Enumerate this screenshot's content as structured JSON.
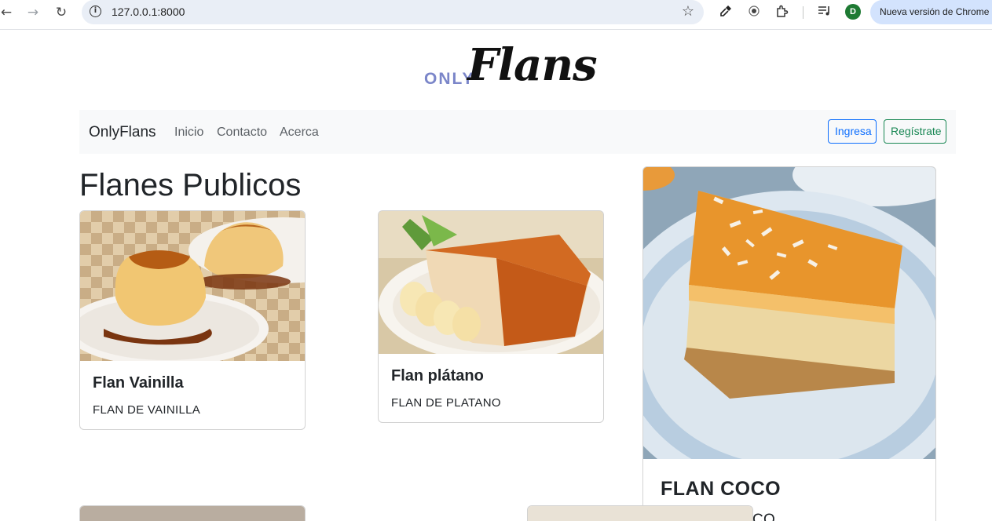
{
  "browser": {
    "url": "127.0.0.1:8000",
    "update_text": "Nueva versión de Chrome d",
    "avatar_initial": "D"
  },
  "logo": {
    "only": "ONLY",
    "flans": "Flans"
  },
  "navbar": {
    "brand": "OnlyFlans",
    "links": [
      "Inicio",
      "Contacto",
      "Acerca"
    ],
    "login_label": "Ingresa",
    "register_label": "Regístrate"
  },
  "page": {
    "title": "Flanes Publicos"
  },
  "cards": [
    {
      "title": "Flan Vainilla",
      "text": "FLAN DE VAINILLA"
    },
    {
      "title": "Flan plátano",
      "text": "FLAN DE PLATANO"
    },
    {
      "title": "FLAN COCO",
      "text": "FLAN DE COCO"
    }
  ],
  "colors": {
    "primary": "#0d6efd",
    "success": "#198754",
    "navbar_bg": "#f8f9fa",
    "logo_accent": "#7b86c9"
  }
}
